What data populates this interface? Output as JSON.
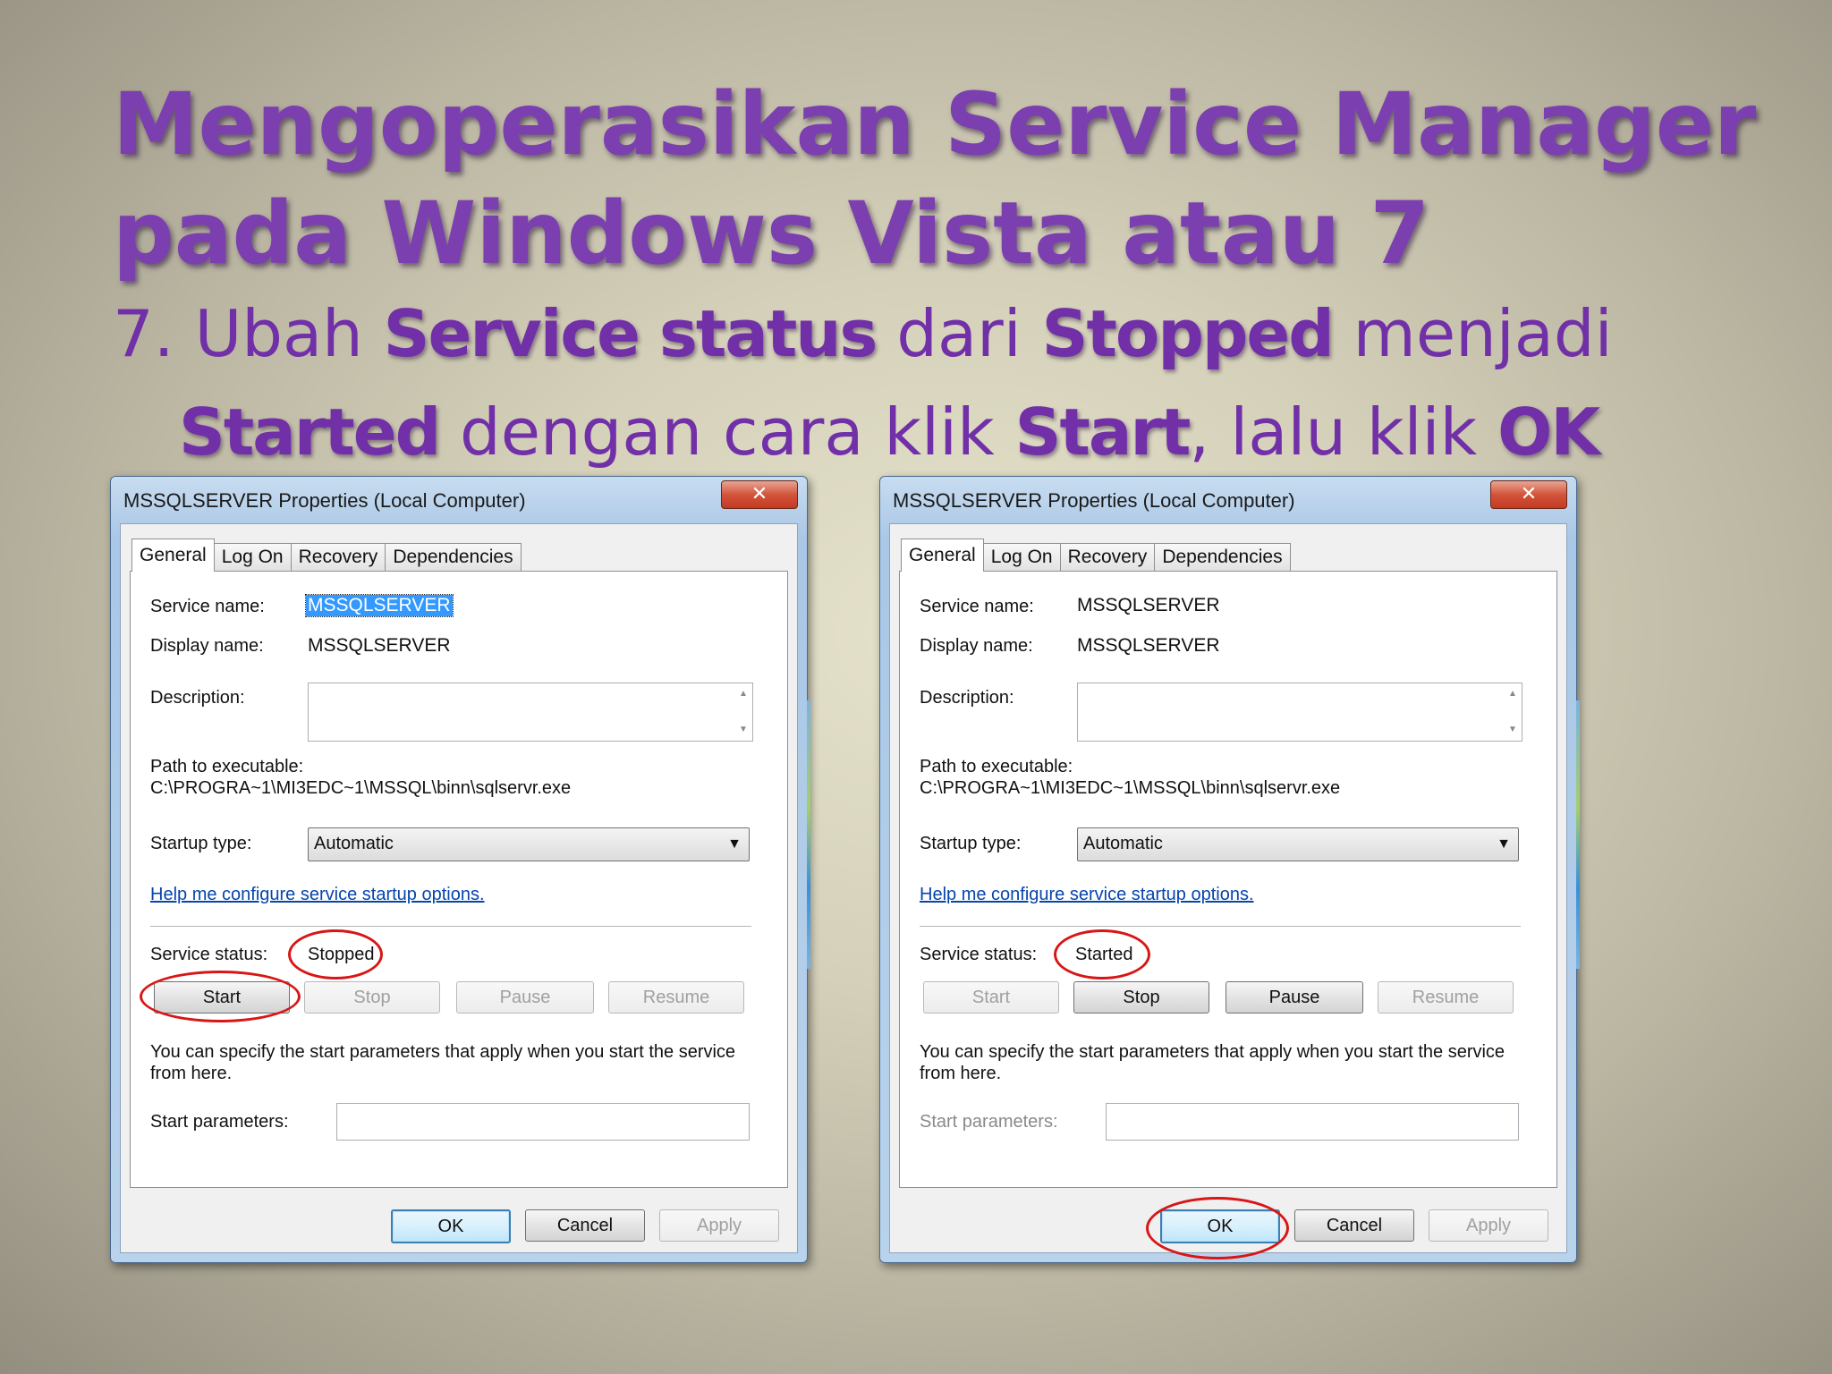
{
  "slide": {
    "title_line1": "Mengoperasikan Service Manager",
    "title_line2": "pada Windows Vista atau 7",
    "instruction": {
      "num": "7. Ubah ",
      "bold1": "Service status",
      "t2": " dari ",
      "bold2": "Stopped",
      "t3": " menjadi",
      "bold3": "Started",
      "t4": " dengan cara klik ",
      "bold4": "Start",
      "t5": ", lalu klik ",
      "bold5": "OK"
    }
  },
  "dialog_left": {
    "title": "MSSQLSERVER Properties (Local Computer)",
    "close_glyph": "✕",
    "tabs": [
      "General",
      "Log On",
      "Recovery",
      "Dependencies"
    ],
    "service_name_label": "Service name:",
    "service_name": "MSSQLSERVER",
    "display_name_label": "Display name:",
    "display_name": "MSSQLSERVER",
    "description_label": "Description:",
    "path_label": "Path to executable:",
    "path": "C:\\PROGRA~1\\MI3EDC~1\\MSSQL\\binn\\sqlservr.exe",
    "startup_type_label": "Startup type:",
    "startup_type": "Automatic",
    "help_link": "Help me configure service startup options.",
    "service_status_label": "Service status:",
    "service_status": "Stopped",
    "btn_start": "Start",
    "btn_stop": "Stop",
    "btn_pause": "Pause",
    "btn_resume": "Resume",
    "info_text": "You can specify the start parameters that apply when you start the service from here.",
    "start_params_label": "Start parameters:",
    "btn_ok": "OK",
    "btn_cancel": "Cancel",
    "btn_apply": "Apply"
  },
  "dialog_right": {
    "title": "MSSQLSERVER Properties (Local Computer)",
    "close_glyph": "✕",
    "tabs": [
      "General",
      "Log On",
      "Recovery",
      "Dependencies"
    ],
    "service_name_label": "Service name:",
    "service_name": "MSSQLSERVER",
    "display_name_label": "Display name:",
    "display_name": "MSSQLSERVER",
    "description_label": "Description:",
    "path_label": "Path to executable:",
    "path": "C:\\PROGRA~1\\MI3EDC~1\\MSSQL\\binn\\sqlservr.exe",
    "startup_type_label": "Startup type:",
    "startup_type": "Automatic",
    "help_link": "Help me configure service startup options.",
    "service_status_label": "Service status:",
    "service_status": "Started",
    "btn_start": "Start",
    "btn_stop": "Stop",
    "btn_pause": "Pause",
    "btn_resume": "Resume",
    "info_text": "You can specify the start parameters that apply when you start the service from here.",
    "start_params_label": "Start parameters:",
    "btn_ok": "OK",
    "btn_cancel": "Cancel",
    "btn_apply": "Apply"
  },
  "colors": {
    "title_purple": "#7b3fb0",
    "highlight_red": "#d81616",
    "link_blue": "#0645ad",
    "selection_blue": "#3399ff"
  }
}
